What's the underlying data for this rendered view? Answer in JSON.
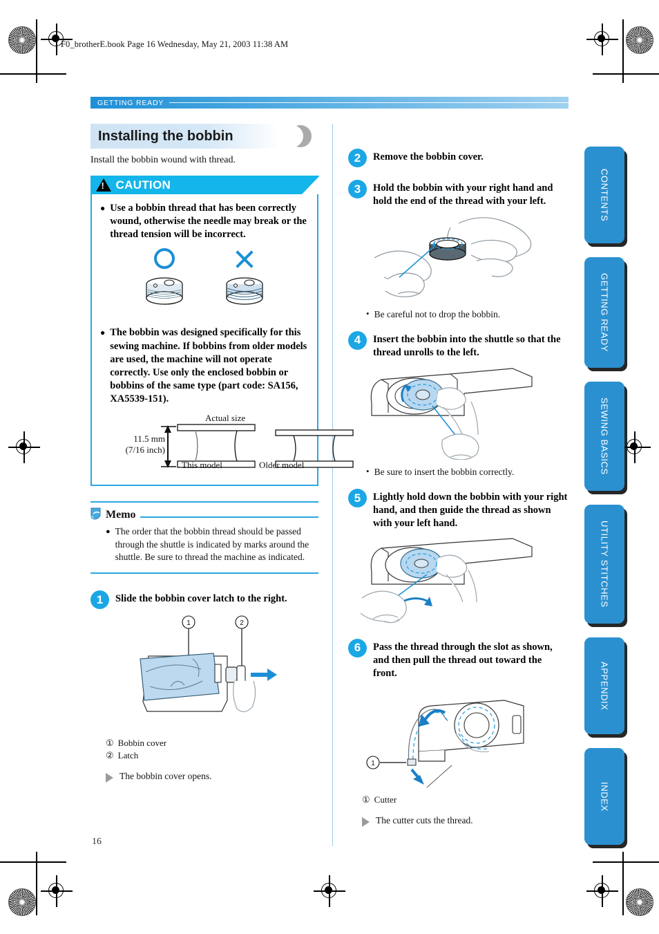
{
  "file_header": "F0_brotherE.book  Page 16  Wednesday, May 21, 2003  11:38 AM",
  "running_head": "GETTING READY",
  "page_number": "16",
  "colors": {
    "brand_blue": "#2b90d0",
    "accent_cyan": "#13b5ea",
    "step_circle": "#1ba7e5",
    "title_band": "#cfe3f4",
    "rule_blue": "#29a8e0"
  },
  "section": {
    "title": "Installing the bobbin",
    "intro": "Install the bobbin wound with thread."
  },
  "caution": {
    "label": "CAUTION",
    "icon": "warning-triangle-icon",
    "items": [
      "Use a bobbin thread that has been correctly wound, otherwise the needle may break or the thread tension will be incorrect.",
      "The bobbin was designed specifically for this sewing machine. If bobbins from older models are used, the machine will not operate correctly. Use only the enclosed bobbin or bobbins of the same type (part code: SA156, XA5539-151)."
    ],
    "ok_mark": "circle-ok-icon",
    "ng_mark": "cross-ng-icon",
    "size_figure": {
      "actual_size_label": "Actual size",
      "dimension_mm": "11.5 mm",
      "dimension_inch": "(7/16 inch)",
      "caption_left": "This model",
      "caption_right": "Older model"
    }
  },
  "memo": {
    "title": "Memo",
    "icon": "memo-page-icon",
    "text": "The order that the bobbin thread should be passed through the shuttle is indicated by marks around the shuttle. Be sure to thread the machine as indicated."
  },
  "steps": [
    {
      "number": "1",
      "text": "Slide the bobbin cover latch to the right.",
      "callouts": [
        {
          "num": "①",
          "label": "Bobbin cover"
        },
        {
          "num": "②",
          "label": "Latch"
        }
      ],
      "result": "The bobbin cover opens."
    },
    {
      "number": "2",
      "text": "Remove the bobbin cover."
    },
    {
      "number": "3",
      "text": "Hold the bobbin with your right hand and hold the end of the thread with your left.",
      "note": "Be careful not to drop the bobbin."
    },
    {
      "number": "4",
      "text": "Insert the bobbin into the shuttle so that the thread unrolls to the left.",
      "note": "Be sure to insert the bobbin correctly."
    },
    {
      "number": "5",
      "text": "Lightly hold down the bobbin with your right hand, and then guide the thread as shown with your left hand."
    },
    {
      "number": "6",
      "text": "Pass the thread through the slot as shown, and then pull the thread out toward the front.",
      "callouts": [
        {
          "num": "①",
          "label": "Cutter"
        }
      ],
      "result": "The cutter cuts the thread."
    }
  ],
  "side_tabs": [
    {
      "label": "CONTENTS"
    },
    {
      "label": "GETTING READY"
    },
    {
      "label": "SEWING BASICS"
    },
    {
      "label": "UTILITY STITCHES"
    },
    {
      "label": "APPENDIX"
    },
    {
      "label": "INDEX"
    }
  ]
}
